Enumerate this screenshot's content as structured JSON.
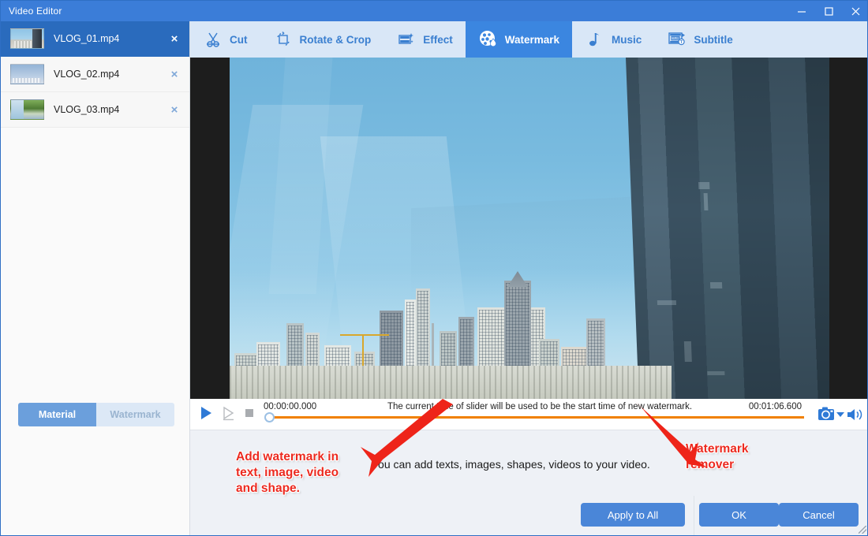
{
  "window": {
    "title": "Video Editor",
    "minimize_icon": "minimize-icon",
    "maximize_icon": "maximize-icon",
    "close_icon": "close-icon"
  },
  "sidebar": {
    "clips": [
      {
        "name": "VLOG_01.mp4",
        "selected": true,
        "close_label": "×"
      },
      {
        "name": "VLOG_02.mp4",
        "selected": false,
        "close_label": "×"
      },
      {
        "name": "VLOG_03.mp4",
        "selected": false,
        "close_label": "×"
      }
    ],
    "tabs": [
      {
        "label": "Material",
        "active": true
      },
      {
        "label": "Watermark",
        "active": false
      }
    ]
  },
  "toolbar": {
    "tabs": [
      {
        "label": "Cut",
        "icon": "scissors-icon",
        "active": false
      },
      {
        "label": "Rotate & Crop",
        "icon": "crop-rotate-icon",
        "active": false
      },
      {
        "label": "Effect",
        "icon": "film-sparkle-icon",
        "active": false
      },
      {
        "label": "Watermark",
        "icon": "watermark-droplet-icon",
        "active": true
      },
      {
        "label": "Music",
        "icon": "music-note-icon",
        "active": false
      },
      {
        "label": "Subtitle",
        "icon": "subtitle-icon",
        "active": false
      }
    ]
  },
  "watermark_bar": {
    "expand_icon": "chevron-down-icon",
    "add_tools": [
      {
        "name": "add-text-watermark",
        "icon": "text-plus-icon"
      },
      {
        "name": "add-image-watermark",
        "icon": "image-plus-icon"
      },
      {
        "name": "add-video-watermark",
        "icon": "video-plus-icon"
      },
      {
        "name": "add-shape-watermark",
        "icon": "shape-plus-icon"
      }
    ],
    "remove_tool": {
      "name": "watermark-remover",
      "icon": "eraser-box-plus-icon"
    }
  },
  "player": {
    "play_icon": "play-icon",
    "play_preview_icon": "play-preview-icon",
    "stop_icon": "stop-icon",
    "current_time": "00:00:00.000",
    "total_time": "00:01:06.600",
    "hint": "The current time of slider will be used to be the start time of new watermark.",
    "snapshot_icon": "camera-icon",
    "snapshot_caret_icon": "caret-down-icon",
    "volume_icon": "volume-icon",
    "progress_percent": 0
  },
  "annotations": {
    "left": "Add watermark in text, image, video and shape.",
    "right": "Watermark remover",
    "center_note": "You can add texts, images, shapes, videos to your video.",
    "color": "#ec2a20"
  },
  "buttons": {
    "apply_to_all": "Apply to All",
    "ok": "OK",
    "cancel": "Cancel"
  },
  "colors": {
    "titlebar": "#3b7dd8",
    "accent": "#4a86d8",
    "tabbar": "#d9e7f7",
    "active_tab": "#3b86e0",
    "selected_row": "#2a6bbd",
    "track": "#f08000",
    "annotation": "#ec2a20"
  }
}
